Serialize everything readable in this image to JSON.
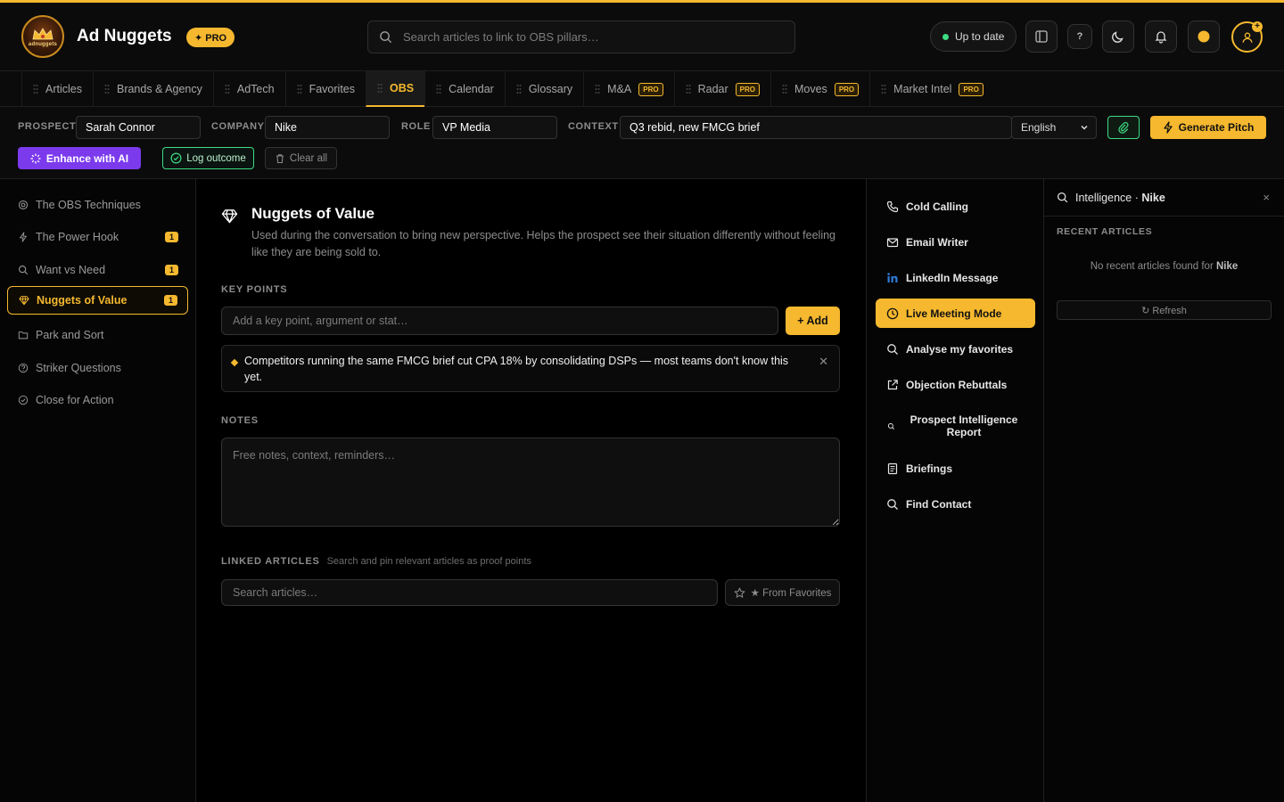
{
  "app": {
    "logo_text": "adnuggets",
    "title": "Ad Nuggets",
    "pro_badge": "✦ PRO"
  },
  "header": {
    "search_placeholder": "Search articles to link to OBS pillars…",
    "status": "Up to date",
    "icons": [
      "panel-icon",
      "help-icon",
      "moon-icon",
      "bell-icon",
      "coin-icon",
      "user-icon"
    ],
    "help_label": "?",
    "avatar_badge": "+"
  },
  "nav": {
    "tabs": [
      {
        "label": "Articles"
      },
      {
        "label": "Brands & Agency"
      },
      {
        "label": "AdTech"
      },
      {
        "label": "Favorites"
      },
      {
        "label": "OBS",
        "active": true
      },
      {
        "label": "Calendar"
      },
      {
        "label": "Glossary"
      },
      {
        "label": "M&A",
        "pro": "PRO"
      },
      {
        "label": "Radar",
        "pro": "PRO"
      },
      {
        "label": "Moves",
        "pro": "PRO"
      },
      {
        "label": "Market Intel",
        "pro": "PRO"
      }
    ]
  },
  "prospect": {
    "prospect_label": "PROSPECT",
    "prospect_value": "Sarah Connor",
    "company_label": "COMPANY",
    "company_value": "Nike",
    "role_label": "ROLE",
    "role_value": "VP Media",
    "context_label": "CONTEXT",
    "context_value": "Q3 rebid, new FMCG brief",
    "language": "English",
    "generate_label": "Generate Pitch",
    "enhance_label": "Enhance with AI",
    "log_label": "Log outcome",
    "clear_label": "Clear all"
  },
  "sidebar": {
    "items": [
      {
        "label": "The OBS Techniques",
        "icon": "target-icon"
      },
      {
        "label": "The Power Hook",
        "icon": "bolt-icon",
        "badge": "1"
      },
      {
        "label": "Want vs Need",
        "icon": "search-icon",
        "badge": "1"
      },
      {
        "label": "Nuggets of Value",
        "icon": "diamond-icon",
        "badge": "1",
        "active": true
      },
      {
        "label": "Park and Sort",
        "icon": "folder-icon"
      },
      {
        "label": "Striker Questions",
        "icon": "question-icon"
      },
      {
        "label": "Close for Action",
        "icon": "check-circle-icon"
      }
    ]
  },
  "main": {
    "title": "Nuggets of Value",
    "description": "Used during the conversation to bring new perspective. Helps the prospect see their situation differently without feeling like they are being sold to.",
    "key_points_label": "KEY POINTS",
    "key_point_placeholder": "Add a key point, argument or stat…",
    "add_label": "+ Add",
    "key_points": [
      "Competitors running the same FMCG brief cut CPA 18% by consolidating DSPs — most teams don't know this yet."
    ],
    "notes_label": "NOTES",
    "notes_placeholder": "Free notes, context, reminders…",
    "linked_label": "LINKED ARTICLES",
    "linked_hint": "Search and pin relevant articles as proof points",
    "linked_placeholder": "Search articles…",
    "favorites_label": "★ From Favorites"
  },
  "tools": {
    "items": [
      {
        "label": "Cold Calling",
        "icon": "phone-icon"
      },
      {
        "label": "Email Writer",
        "icon": "mail-icon"
      },
      {
        "label": "LinkedIn Message",
        "icon": "linkedin-icon"
      },
      {
        "label": "Live Meeting Mode",
        "icon": "clock-icon",
        "active": true
      },
      {
        "label": "Analyse my favorites",
        "icon": "search-icon"
      },
      {
        "label": "Objection Rebuttals",
        "icon": "external-link-icon"
      },
      {
        "label": "Prospect Intelligence Report",
        "icon": "search-small-icon"
      },
      {
        "label": "Briefings",
        "icon": "document-icon"
      },
      {
        "label": "Find Contact",
        "icon": "search-icon"
      }
    ]
  },
  "intel": {
    "title": "Intelligence",
    "separator": "·",
    "company": "Nike",
    "recent_label": "RECENT ARTICLES",
    "empty_text": "No recent articles found for",
    "empty_company": "Nike",
    "refresh_label": "↻ Refresh",
    "close_label": "×"
  },
  "colors": {
    "accent": "#f5b82e",
    "success": "#3ddc84",
    "ai": "#7c3aed",
    "background": "#000000"
  }
}
